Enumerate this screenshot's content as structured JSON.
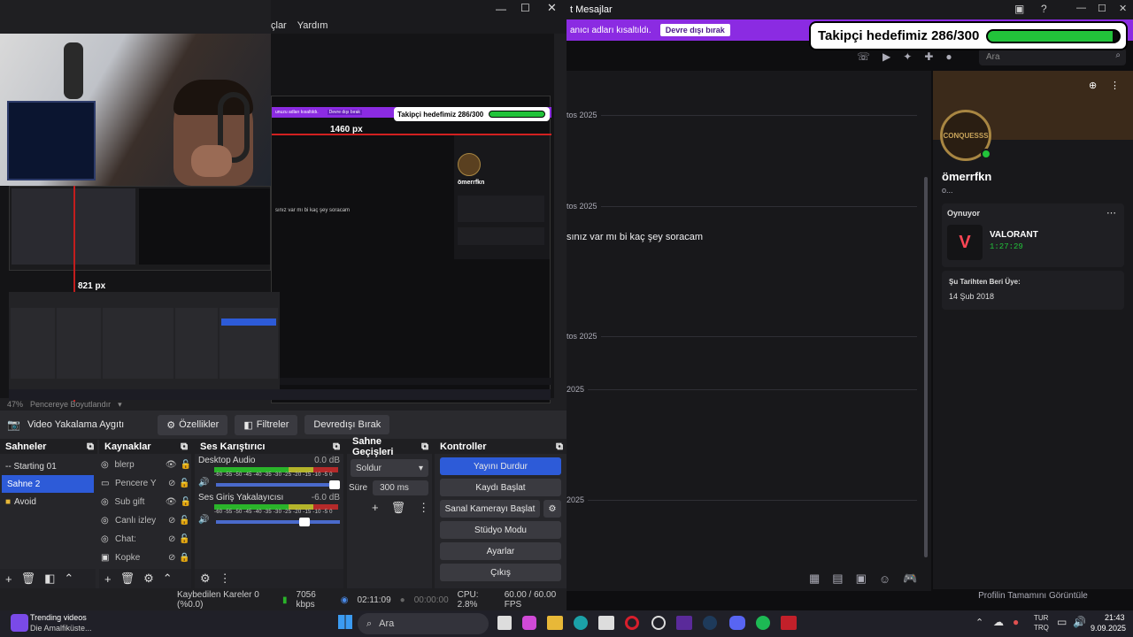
{
  "obs": {
    "menu": [
      "çlar",
      "Yardım"
    ],
    "preview_status": {
      "zoom": "47%",
      "resize_label": "Pencereye Boyutlandır"
    },
    "nested": {
      "banner_text": "unuzu adları kısaltıldı.",
      "banner_button": "Devre dışı bırak",
      "goal_text": "Takipçi hedefimiz 286/300",
      "px_label_top": "1460 px",
      "chat_text": "sınız var mı bi kaç şey soracam",
      "profile_name": "ömerrfkn"
    },
    "px_label_left": "821 px",
    "source_toolbar": {
      "source_name": "Video Yakalama Aygıtı",
      "properties_button": "Özellikler",
      "filters_button": "Filtreler",
      "deactivate_button": "Devredışı Bırak"
    },
    "scenes": {
      "title": "Sahneler",
      "items": [
        "-- Starting 01",
        "Sahne 2",
        "Avoid"
      ],
      "active_index": 1
    },
    "sources": {
      "title": "Kaynaklar",
      "items": [
        "blerp",
        "Pencere Y",
        "Sub gift",
        "Canlı izley",
        "Chat:",
        "Kopke"
      ]
    },
    "mixer": {
      "title": "Ses Karıştırıcı",
      "channels": [
        {
          "name": "Desktop Audio",
          "level": "0.0 dB",
          "volume": 1.0
        },
        {
          "name": "Ses Giriş Yakalayıcısı",
          "level": "-6.0 dB",
          "volume": 0.75
        }
      ],
      "scale": "-60 -55 -50 -45 -40 -35 -30 -25 -20 -15 -10 -5 0"
    },
    "transitions": {
      "title": "Sahne Geçişleri",
      "selected": "Soldur",
      "duration_label": "Süre",
      "duration_value": "300 ms"
    },
    "controls": {
      "title": "Kontroller",
      "buttons": [
        "Yayını Durdur",
        "Kaydı Başlat",
        "Sanal Kamerayı Başlat",
        "Stüdyo Modu",
        "Ayarlar",
        "Çıkış"
      ]
    },
    "status": {
      "dropped": "Kaybedilen Kareler 0 (%0.0)",
      "bitrate": "7056 kbps",
      "stream_time": "02:11:09",
      "rec_time": "00:00:00",
      "cpu": "CPU: 2.8%",
      "fps": "60.00 / 60.00 FPS"
    }
  },
  "twitch": {
    "window_title": "t Mesajlar",
    "banner_text": "anıcı adları kısaltıldı.",
    "banner_button": "Devre dışı bırak",
    "goal": {
      "text": "Takipçi hedefimiz 286/300",
      "current": 286,
      "target": 300
    },
    "search_placeholder": "Ara",
    "date_labels": [
      "tos 2025",
      "tos 2025",
      "tos 2025",
      "2025",
      "2025"
    ],
    "message": "sınız var mı bi kaç şey soracam",
    "profile": {
      "avatar_text": "CONQUESSS",
      "name": "ömerrfkn",
      "sub": "o...",
      "playing_label": "Oynuyor",
      "game": "VALORANT",
      "playtime": "1:27:29",
      "member_label": "Şu Tarihten Beri Üye:",
      "member_date": "14 Şub 2018",
      "full_profile": "Profilin Tamamını Görüntüle"
    },
    "accent": "#8b2be2",
    "goal_color": "#22c33a"
  },
  "taskbar": {
    "news_title": "Trending videos",
    "news_sub": "Die Amalfiküste...",
    "search_placeholder": "Ara",
    "lang_top": "TUR",
    "lang_bottom": "TRQ",
    "time": "21:43",
    "date": "9.09.2025"
  }
}
